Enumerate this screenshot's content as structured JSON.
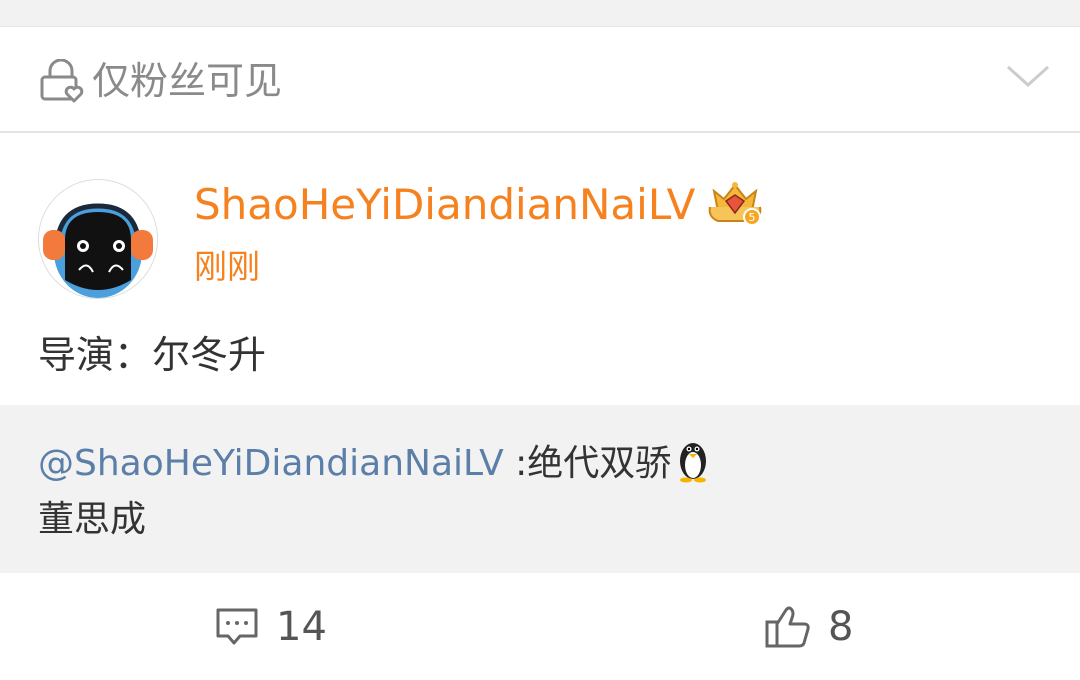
{
  "visibility": {
    "label": "仅粉丝可见",
    "lock_icon": "lock-heart-icon",
    "expand_icon": "chevron-down-icon"
  },
  "post": {
    "username": "ShaoHeYiDiandianNaiLV",
    "timestamp": "刚刚",
    "text": "导演：尔冬升",
    "badge_icon": "crown-badge-icon",
    "name_color": "#f5811f"
  },
  "quote": {
    "mention": "@ShaoHeYiDiandianNaiLV",
    "text": " :绝代双骄",
    "emoji_icon": "penguin-icon",
    "line2": "董思成",
    "mention_color": "#5b7fa9"
  },
  "actions": {
    "comment": {
      "icon": "comment-icon",
      "count": "14"
    },
    "like": {
      "icon": "thumbs-up-icon",
      "count": "8"
    }
  }
}
